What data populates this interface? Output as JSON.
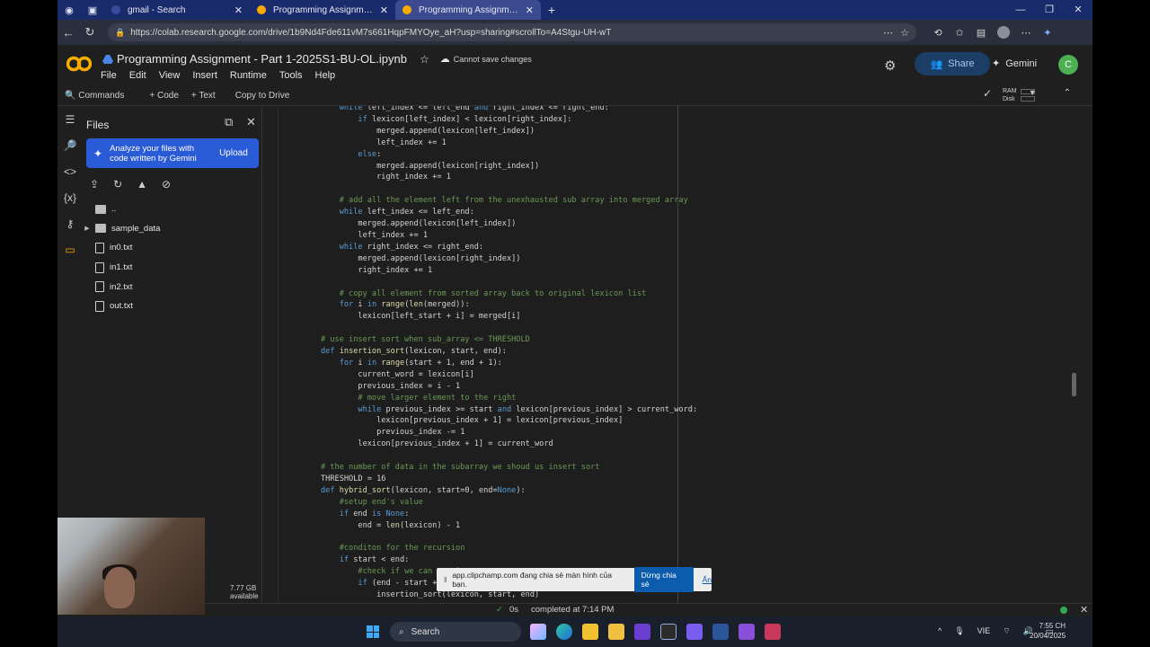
{
  "browser": {
    "tabs": [
      {
        "title": "gmail - Search",
        "active": false
      },
      {
        "title": "Programming Assignment - Part",
        "active": false
      },
      {
        "title": "Programming Assignment - Part",
        "active": true
      }
    ],
    "url": "https://colab.research.google.com/drive/1b9Nd4Fde611vM7s661HqpFMYOye_aH?usp=sharing#scrollTo=A4Stgu-UH-wT"
  },
  "colab": {
    "notebook_title": "Programming Assignment - Part 1-2025S1-BU-OL.ipynb",
    "save_status": "Cannot save changes",
    "menus": [
      "File",
      "Edit",
      "View",
      "Insert",
      "Runtime",
      "Tools",
      "Help"
    ],
    "share_label": "Share",
    "gemini_label": "Gemini",
    "profile_initial": "C",
    "toolbar": {
      "commands": "Commands",
      "code": "+ Code",
      "text": "+ Text",
      "copy": "Copy to Drive",
      "ram": "RAM",
      "disk": "Disk"
    }
  },
  "files_panel": {
    "title": "Files",
    "gemini_card": {
      "text": "Analyze your files with code written by Gemini",
      "button": "Upload"
    },
    "tree": [
      {
        "name": "..",
        "type": "folder"
      },
      {
        "name": "sample_data",
        "type": "folder"
      },
      {
        "name": "in0.txt",
        "type": "file"
      },
      {
        "name": "in1.txt",
        "type": "file"
      },
      {
        "name": "in2.txt",
        "type": "file"
      },
      {
        "name": "out.txt",
        "type": "file"
      }
    ],
    "disk_available": "7.77 GB available"
  },
  "status_bar": {
    "duration": "0s",
    "completed": "completed at 7:14 PM"
  },
  "share_banner": {
    "text": "app.clipchamp.com đang chia sẻ màn hình của bạn.",
    "stop": "Dừng chia sẻ",
    "hide": "Ẩn"
  },
  "taskbar": {
    "search": "Search",
    "lang": "VIE",
    "time": "7:55 CH",
    "date": "20/04/2025"
  },
  "colors": {
    "keyword": "#569cd6",
    "comment": "#6a9955",
    "accent": "#2a5bd7"
  }
}
